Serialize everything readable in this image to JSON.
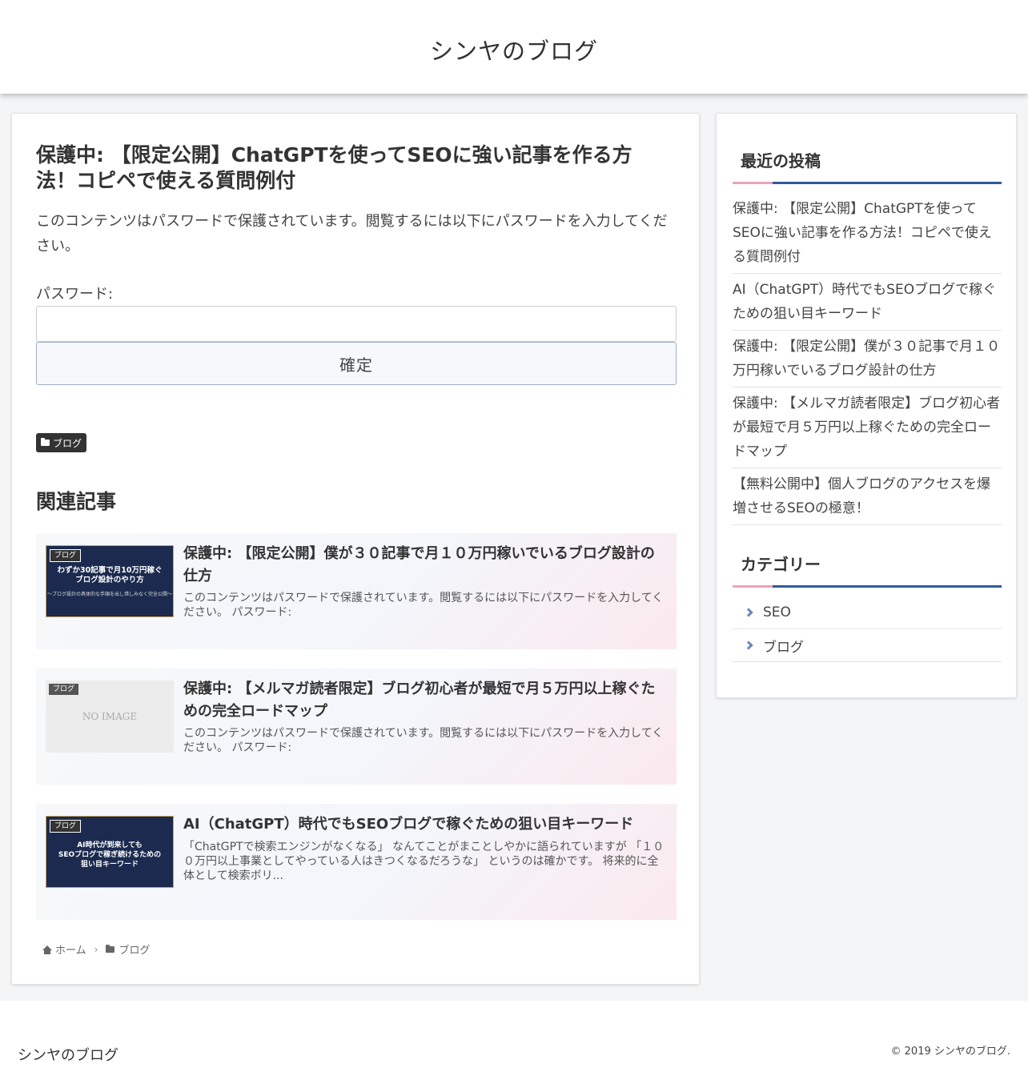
{
  "header": {
    "site_title": "シンヤのブログ"
  },
  "article": {
    "title": "保護中: 【限定公開】ChatGPTを使ってSEOに強い記事を作る方法！コピペで使える質問例付",
    "protected_message": "このコンテンツはパスワードで保護されています。閲覧するには以下にパスワードを入力してください。",
    "password_label": "パスワード:",
    "password_value": "",
    "submit_label": "確定",
    "category_tag": "ブログ"
  },
  "related": {
    "heading": "関連記事",
    "items": [
      {
        "label": "ブログ",
        "thumb_text": "わずか30記事で月10万円稼ぐ\nブログ設計のやり方",
        "thumb_sub": "〜ブログ設計の具体的な手順を出し惜しみなく完全公開〜",
        "title": "保護中: 【限定公開】僕が３０記事で月１０万円稼いでいるブログ設計の仕方",
        "excerpt": "このコンテンツはパスワードで保護されています。閲覧するには以下にパスワードを入力してください。 パスワード:"
      },
      {
        "label": "ブログ",
        "thumb_text": "NO IMAGE",
        "title": "保護中: 【メルマガ読者限定】ブログ初心者が最短で月５万円以上稼ぐための完全ロードマップ",
        "excerpt": "このコンテンツはパスワードで保護されています。閲覧するには以下にパスワードを入力してください。 パスワード:"
      },
      {
        "label": "ブログ",
        "thumb_text": "AI時代が到来しても\nSEOブログで稼ぎ続けるための\n狙い目キーワード",
        "title": "AI（ChatGPT）時代でもSEOブログで稼ぐための狙い目キーワード",
        "excerpt": "「ChatGPTで検索エンジンがなくなる」 なんてことがまことしやかに語られていますが 「１００万円以上事業としてやっている人はきつくなるだろうな」 というのは確かです。 将来的に全体として検索ボリ..."
      }
    ]
  },
  "breadcrumb": {
    "home": "ホーム",
    "category": "ブログ"
  },
  "sidebar": {
    "recent_title": "最近の投稿",
    "recent_posts": [
      "保護中: 【限定公開】ChatGPTを使ってSEOに強い記事を作る方法！コピペで使える質問例付",
      "AI（ChatGPT）時代でもSEOブログで稼ぐための狙い目キーワード",
      "保護中: 【限定公開】僕が３０記事で月１０万円稼いでいるブログ設計の仕方",
      "保護中: 【メルマガ読者限定】ブログ初心者が最短で月５万円以上稼ぐための完全ロードマップ",
      "【無料公開中】個人ブログのアクセスを爆増させるSEOの極意！"
    ],
    "category_title": "カテゴリー",
    "categories": [
      "SEO",
      "ブログ"
    ]
  },
  "footer": {
    "site_title": "シンヤのブログ",
    "copyright": "© 2019 シンヤのブログ."
  },
  "colors": {
    "accent_blue": "#2f5b9b",
    "accent_pink": "#e8a4b8",
    "thumb_navy": "#1b2a4e"
  }
}
